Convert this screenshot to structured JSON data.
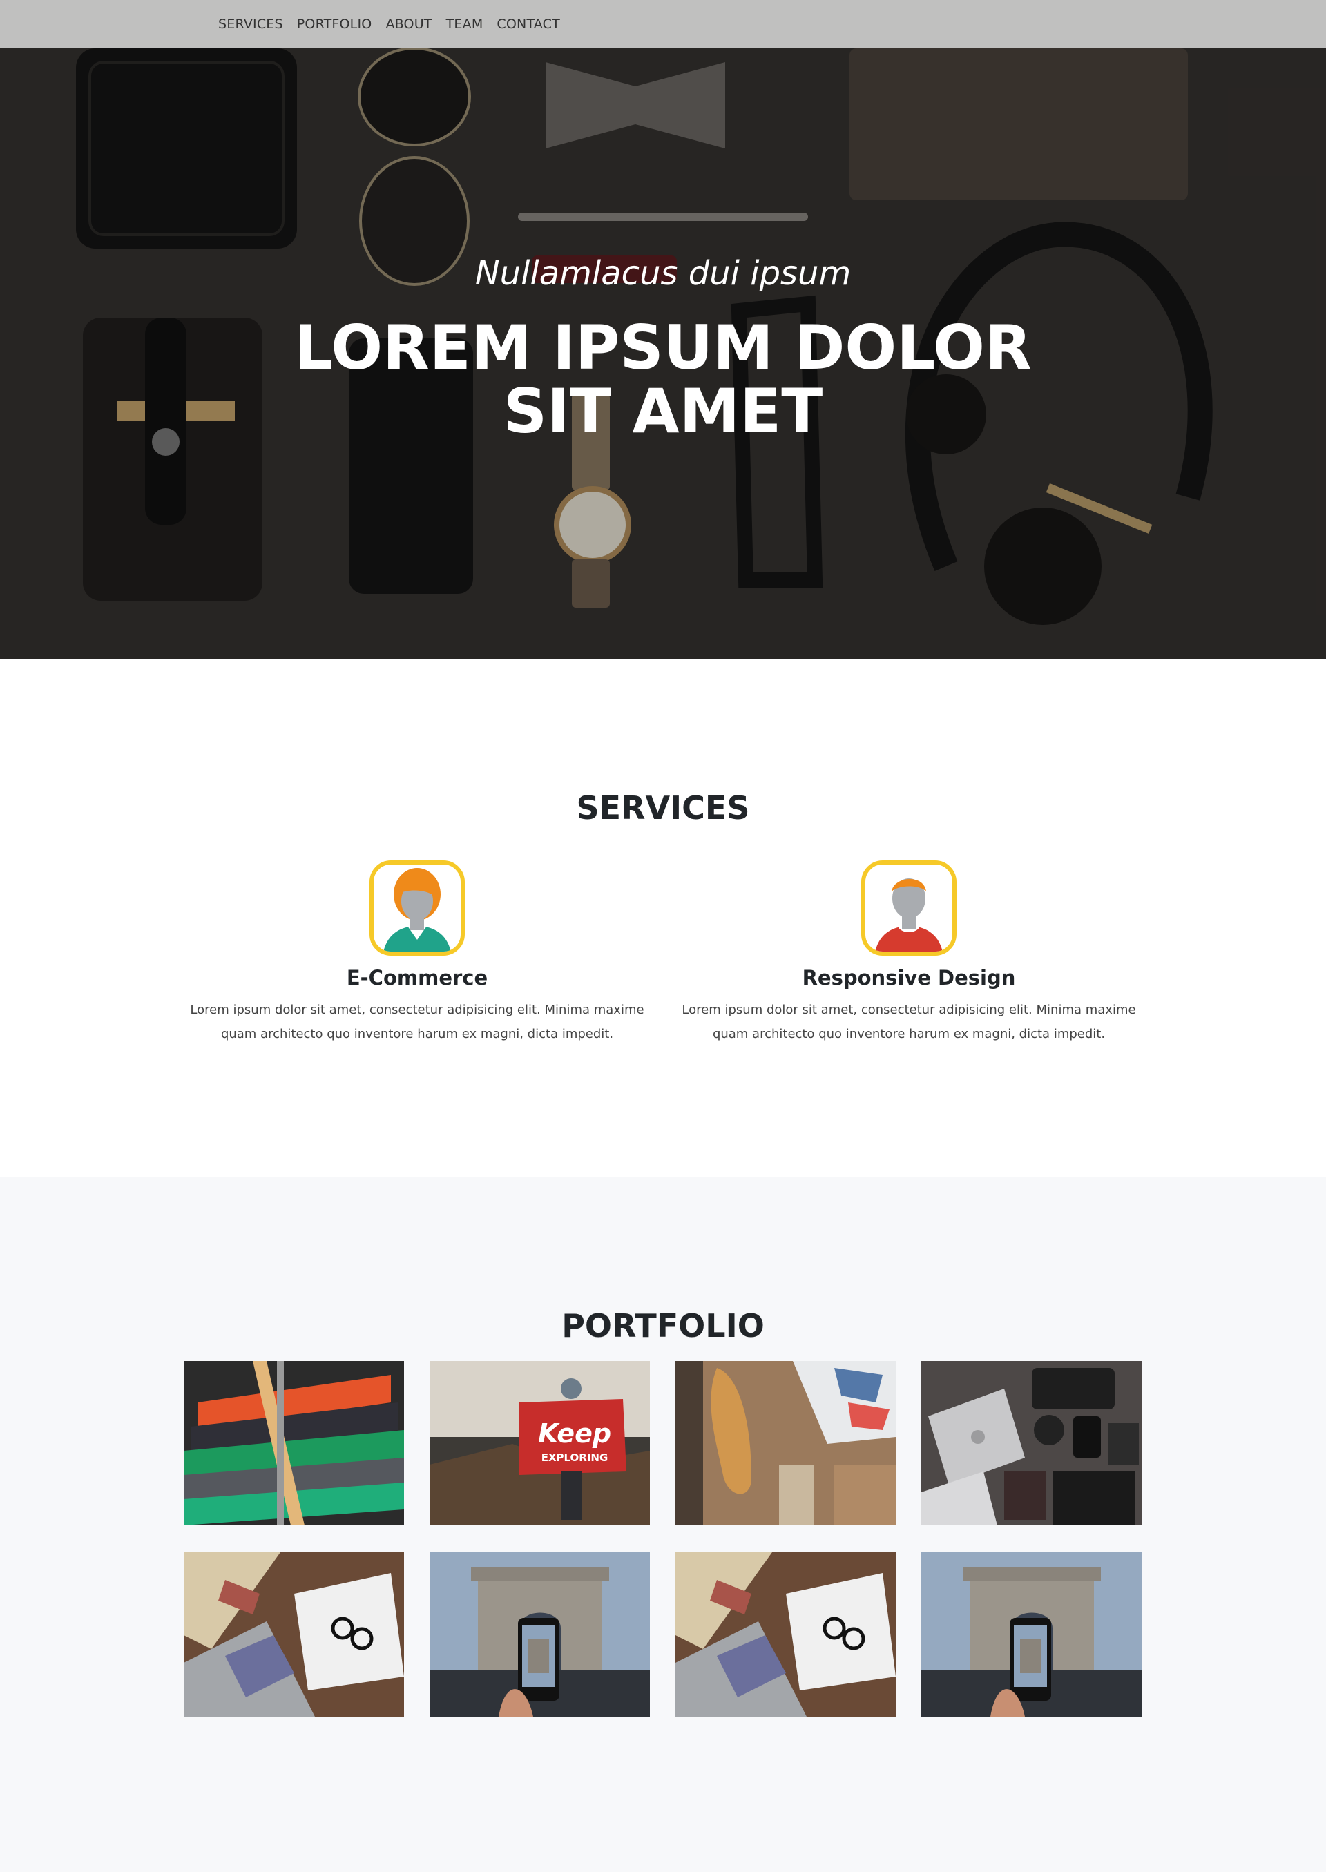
{
  "nav": {
    "items": [
      "SERVICES",
      "PORTFOLIO",
      "ABOUT",
      "TEAM",
      "CONTACT"
    ]
  },
  "hero": {
    "subtitle": "Nullamlacus dui ipsum",
    "title": "LOREM IPSUM DOLOR SIT AMET",
    "image": "flat-lay of wallet, sunglasses, bow tie, pen, notebook, phone, watch, glasses, headphones"
  },
  "services": {
    "title": "SERVICES",
    "items": [
      {
        "icon": "woman-avatar-icon",
        "title": "E-Commerce",
        "text": "Lorem ipsum dolor sit amet, consectetur adipisicing elit. Minima maxime quam architecto quo inventore harum ex magni, dicta impedit."
      },
      {
        "icon": "man-avatar-icon",
        "title": "Responsive Design",
        "text": "Lorem ipsum dolor sit amet, consectetur adipisicing elit. Minima maxime quam architecto quo inventore harum ex magni, dicta impedit."
      }
    ]
  },
  "portfolio": {
    "title": "PORTFOLIO",
    "images": [
      "shirts-on-hangers-image",
      "keep-exploring-flag-image",
      "shoe-lasts-workshop-image",
      "laptop-camera-flatlay-image",
      "desk-laptop-glasses-image",
      "arc-de-triomphe-phone-image",
      "desk-laptop-glasses-image",
      "arc-de-triomphe-phone-image"
    ],
    "keep_text": "Keep",
    "exploring_text": "EXPLORING"
  },
  "colors": {
    "nav_bg": "#c8c8c8",
    "hero_bg": "#2f2d2b",
    "avatar_border": "#f6c928",
    "portfolio_bg": "#f7f8fa"
  }
}
